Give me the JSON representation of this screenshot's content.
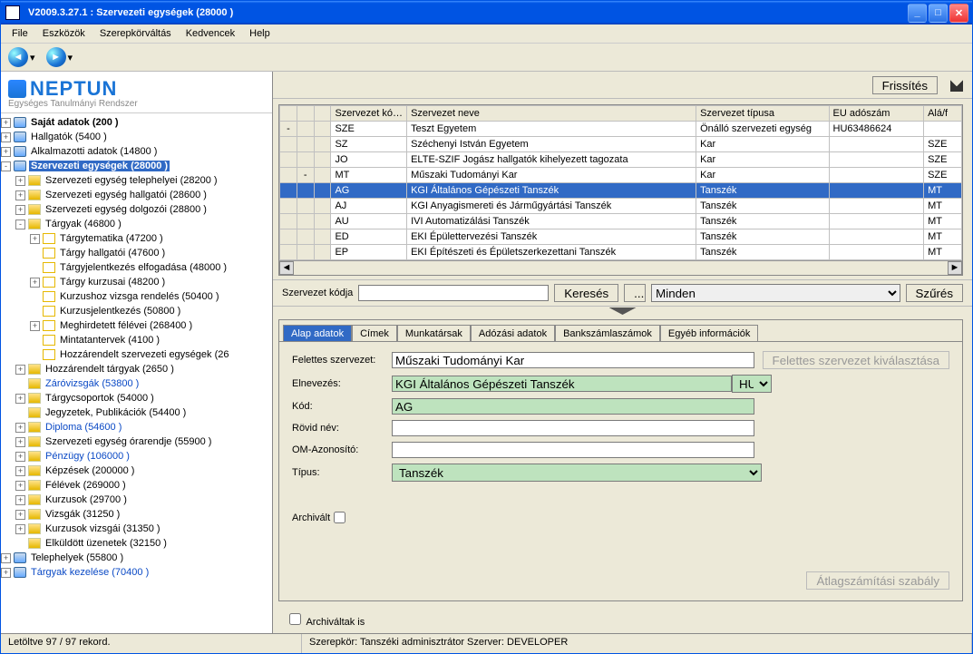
{
  "window_title": "V2009.3.27.1 : Szervezeti egységek (28000 )",
  "menu": [
    "File",
    "Eszközök",
    "Szerepkörváltás",
    "Kedvencek",
    "Help"
  ],
  "logo": {
    "brand": "NEPTUN",
    "sub": "Egységes Tanulmányi Rendszer"
  },
  "tree": [
    {
      "d": 0,
      "exp": "+",
      "kind": "db",
      "label": "Saját adatok (200  )",
      "bold": true
    },
    {
      "d": 0,
      "exp": "+",
      "kind": "db",
      "label": "Hallgatók (5400  )"
    },
    {
      "d": 0,
      "exp": "+",
      "kind": "db",
      "label": "Alkalmazotti adatok (14800  )"
    },
    {
      "d": 0,
      "exp": "-",
      "kind": "db",
      "label": "Szervezeti egységek (28000  )",
      "sel": true,
      "bold": true
    },
    {
      "d": 1,
      "exp": "+",
      "kind": "folder",
      "label": "Szervezeti egység telephelyei (28200  )"
    },
    {
      "d": 1,
      "exp": "+",
      "kind": "folder",
      "label": "Szervezeti egység hallgatói (28600  )"
    },
    {
      "d": 1,
      "exp": "+",
      "kind": "folder",
      "label": "Szervezeti egység dolgozói (28800  )"
    },
    {
      "d": 1,
      "exp": "-",
      "kind": "folder",
      "label": "Tárgyak (46800  )"
    },
    {
      "d": 2,
      "exp": "+",
      "kind": "page",
      "label": "Tárgytematika (47200  )"
    },
    {
      "d": 2,
      "exp": "",
      "kind": "page",
      "label": "Tárgy hallgatói (47600  )"
    },
    {
      "d": 2,
      "exp": "",
      "kind": "page",
      "label": "Tárgyjelentkezés elfogadása (48000  )"
    },
    {
      "d": 2,
      "exp": "+",
      "kind": "page",
      "label": "Tárgy kurzusai (48200  )"
    },
    {
      "d": 2,
      "exp": "",
      "kind": "page",
      "label": "Kurzushoz vizsga rendelés (50400  )"
    },
    {
      "d": 2,
      "exp": "",
      "kind": "page",
      "label": "Kurzusjelentkezés (50800  )"
    },
    {
      "d": 2,
      "exp": "+",
      "kind": "page",
      "label": "Meghirdetett félévei (268400  )"
    },
    {
      "d": 2,
      "exp": "",
      "kind": "page",
      "label": "Mintatantervek (4100  )"
    },
    {
      "d": 2,
      "exp": "",
      "kind": "page",
      "label": "Hozzárendelt szervezeti egységek (26"
    },
    {
      "d": 1,
      "exp": "+",
      "kind": "folder",
      "label": "Hozzárendelt tárgyak (2650  )"
    },
    {
      "d": 1,
      "exp": "",
      "kind": "folder",
      "label": "Záróvizsgák (53800  )",
      "link": true
    },
    {
      "d": 1,
      "exp": "+",
      "kind": "folder",
      "label": "Tárgycsoportok (54000  )"
    },
    {
      "d": 1,
      "exp": "",
      "kind": "folder",
      "label": "Jegyzetek, Publikációk (54400  )"
    },
    {
      "d": 1,
      "exp": "+",
      "kind": "folder",
      "label": "Diploma (54600  )",
      "link": true
    },
    {
      "d": 1,
      "exp": "+",
      "kind": "folder",
      "label": "Szervezeti egység órarendje (55900  )"
    },
    {
      "d": 1,
      "exp": "+",
      "kind": "folder",
      "label": "Pénzügy (106000  )",
      "link": true
    },
    {
      "d": 1,
      "exp": "+",
      "kind": "folder",
      "label": "Képzések (200000  )"
    },
    {
      "d": 1,
      "exp": "+",
      "kind": "folder",
      "label": "Félévek (269000  )"
    },
    {
      "d": 1,
      "exp": "+",
      "kind": "folder",
      "label": "Kurzusok (29700  )"
    },
    {
      "d": 1,
      "exp": "+",
      "kind": "folder",
      "label": "Vizsgák (31250  )"
    },
    {
      "d": 1,
      "exp": "+",
      "kind": "folder",
      "label": "Kurzusok vizsgái (31350  )"
    },
    {
      "d": 1,
      "exp": "",
      "kind": "folder",
      "label": "Elküldött üzenetek (32150  )"
    },
    {
      "d": 0,
      "exp": "+",
      "kind": "db",
      "label": "Telephelyek (55800  )"
    },
    {
      "d": 0,
      "exp": "+",
      "kind": "db",
      "label": "Tárgyak kezelése (70400  )",
      "link": true
    }
  ],
  "refresh_btn": "Frissítés",
  "grid": {
    "headers": [
      "Szervezet kódja",
      "Szervezet neve",
      "Szervezet típusa",
      "EU adószám",
      "Alá/f"
    ],
    "rows": [
      {
        "ind": 0,
        "exp": "-",
        "c": [
          "SZE",
          "Teszt Egyetem",
          "Önálló szervezeti egység",
          "HU63486624",
          ""
        ]
      },
      {
        "ind": 1,
        "exp": "",
        "c": [
          "SZ",
          "Széchenyi István Egyetem",
          "Kar",
          "",
          "SZE"
        ]
      },
      {
        "ind": 1,
        "exp": "",
        "c": [
          "JO",
          "ELTE-SZIF Jogász hallgatók kihelyezett tagozata",
          "Kar",
          "",
          "SZE"
        ]
      },
      {
        "ind": 1,
        "exp": "-",
        "c": [
          "MT",
          "Műszaki Tudományi Kar",
          "Kar",
          "",
          "SZE"
        ]
      },
      {
        "ind": 2,
        "exp": "",
        "c": [
          "AG",
          "KGI Általános Gépészeti Tanszék",
          "Tanszék",
          "",
          "MT"
        ],
        "sel": true
      },
      {
        "ind": 2,
        "exp": "",
        "c": [
          "AJ",
          "KGI Anyagismereti és Járműgyártási Tanszék",
          "Tanszék",
          "",
          "MT"
        ]
      },
      {
        "ind": 2,
        "exp": "",
        "c": [
          "AU",
          "IVI Automatizálási Tanszék",
          "Tanszék",
          "",
          "MT"
        ]
      },
      {
        "ind": 2,
        "exp": "",
        "c": [
          "ED",
          "EKI Épülettervezési Tanszék",
          "Tanszék",
          "",
          "MT"
        ]
      },
      {
        "ind": 2,
        "exp": "",
        "c": [
          "EP",
          "EKI Építészeti és Épületszerkezettani Tanszék",
          "Tanszék",
          "",
          "MT"
        ]
      }
    ]
  },
  "search": {
    "label": "Szervezet kódja",
    "value": "",
    "search_btn": "Keresés",
    "dots": "...",
    "dropdown": "Minden",
    "filter_btn": "Szűrés"
  },
  "tabs": [
    "Alap adatok",
    "Címek",
    "Munkatársak",
    "Adózási adatok",
    "Bankszámlaszámok",
    "Egyéb információk"
  ],
  "detail": {
    "felettes_label": "Felettes szervezet:",
    "felettes": "Műszaki Tudományi Kar",
    "felettes_btn": "Felettes szervezet kiválasztása",
    "elnev_label": "Elnevezés:",
    "elnev": "KGI Általános Gépészeti Tanszék",
    "lang": "HU",
    "kod_label": "Kód:",
    "kod": "AG",
    "rovid_label": "Rövid név:",
    "rovid": "",
    "om_label": "OM-Azonosító:",
    "om": "",
    "tipus_label": "Típus:",
    "tipus": "Tanszék",
    "archivalt_label": "Archivált",
    "atlag_btn": "Átlagszámítási szabály",
    "archivaltak_is": "Archiváltak is"
  },
  "status": {
    "left": "Letöltve 97 / 97 rekord.",
    "right": "Szerepkör: Tanszéki adminisztrátor   Szerver: DEVELOPER"
  }
}
